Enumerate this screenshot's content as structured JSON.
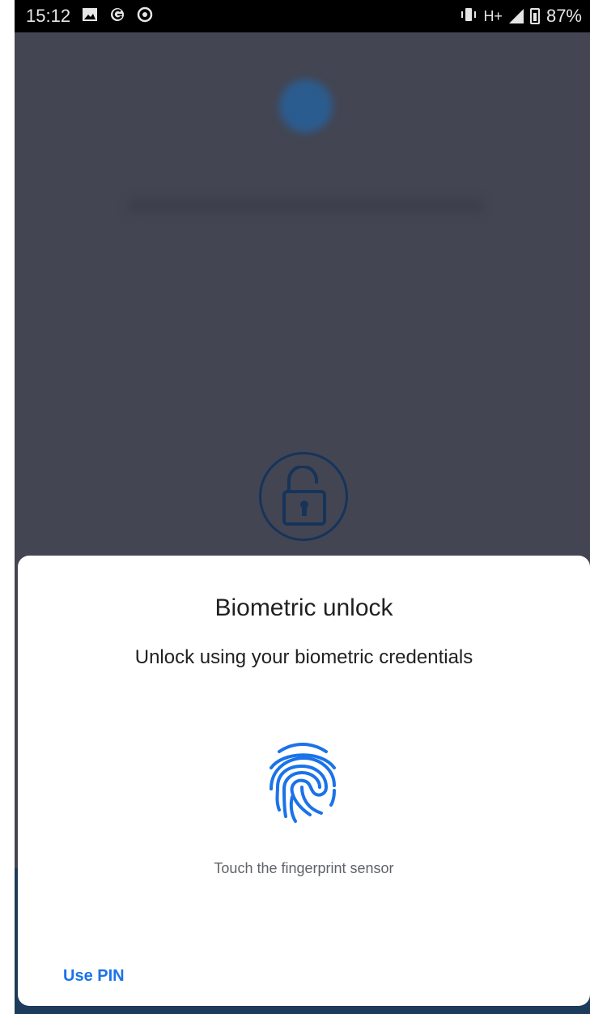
{
  "status_bar": {
    "time": "15:12",
    "network": "H+",
    "battery": "87%",
    "icons": [
      "image-icon",
      "g-icon",
      "sync-icon",
      "vibrate-icon",
      "signal-icon",
      "battery-icon"
    ]
  },
  "dialog": {
    "title": "Biometric unlock",
    "subtitle": "Unlock using your biometric credentials",
    "hint": "Touch the fingerprint sensor",
    "use_pin_label": "Use PIN"
  },
  "colors": {
    "accent": "#1a73e8",
    "background_dim": "#434552",
    "lock_ring": "#16345a"
  }
}
